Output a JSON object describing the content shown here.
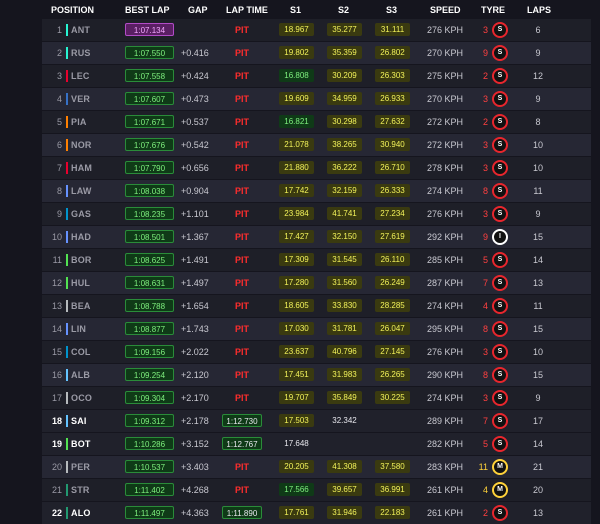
{
  "headers": {
    "position": "POSITION",
    "best_lap": "BEST LAP",
    "gap": "GAP",
    "lap_time": "LAP TIME",
    "s1": "S1",
    "s2": "S2",
    "s3": "S3",
    "speed": "SPEED",
    "tyre": "TYRE",
    "laps": "LAPS"
  },
  "colors": {
    "background": "#15151e",
    "pit": "#ff2d2d",
    "best_green": "#2a8c39",
    "best_purple": "#b24bc7",
    "sector_yellow": "#f3f35a",
    "soft_tyre": "#e8262d",
    "medium_tyre": "#ffd23a",
    "inter_tyre": "#ffffff"
  },
  "rows": [
    {
      "pos": "1",
      "team_color": "#27f4d2",
      "driver": "ANT",
      "best": "1:07.134",
      "best_kind": "purple",
      "gap": "",
      "lap": "PIT",
      "s1": "18.967",
      "s1c": "y",
      "s2": "35.277",
      "s2c": "y",
      "s3": "31.111",
      "s3c": "y",
      "speed": "276 KPH",
      "tyre_age": "3",
      "tyre": "S",
      "tyre_kind": "soft",
      "laps": "6"
    },
    {
      "pos": "2",
      "team_color": "#27f4d2",
      "driver": "RUS",
      "best": "1:07.550",
      "best_kind": "green",
      "gap": "+0.416",
      "lap": "PIT",
      "s1": "19.802",
      "s1c": "y",
      "s2": "35.359",
      "s2c": "y",
      "s3": "26.802",
      "s3c": "y",
      "speed": "270 KPH",
      "tyre_age": "9",
      "tyre": "S",
      "tyre_kind": "soft",
      "laps": "9"
    },
    {
      "pos": "3",
      "team_color": "#e8002d",
      "driver": "LEC",
      "best": "1:07.558",
      "best_kind": "green",
      "gap": "+0.424",
      "lap": "PIT",
      "s1": "16.808",
      "s1c": "g",
      "s2": "30.209",
      "s2c": "y",
      "s3": "26.303",
      "s3c": "y",
      "speed": "275 KPH",
      "tyre_age": "2",
      "tyre": "S",
      "tyre_kind": "soft",
      "laps": "12"
    },
    {
      "pos": "4",
      "team_color": "#3671c6",
      "driver": "VER",
      "best": "1:07.607",
      "best_kind": "green",
      "gap": "+0.473",
      "lap": "PIT",
      "s1": "19.609",
      "s1c": "y",
      "s2": "34.959",
      "s2c": "y",
      "s3": "26.933",
      "s3c": "y",
      "speed": "270 KPH",
      "tyre_age": "3",
      "tyre": "S",
      "tyre_kind": "soft",
      "laps": "9"
    },
    {
      "pos": "5",
      "team_color": "#ff8000",
      "driver": "PIA",
      "best": "1:07.671",
      "best_kind": "green",
      "gap": "+0.537",
      "lap": "PIT",
      "s1": "16.821",
      "s1c": "g",
      "s2": "30.298",
      "s2c": "y",
      "s3": "27.632",
      "s3c": "y",
      "speed": "272 KPH",
      "tyre_age": "2",
      "tyre": "S",
      "tyre_kind": "soft",
      "laps": "8"
    },
    {
      "pos": "6",
      "team_color": "#ff8000",
      "driver": "NOR",
      "best": "1:07.676",
      "best_kind": "green",
      "gap": "+0.542",
      "lap": "PIT",
      "s1": "21.078",
      "s1c": "y",
      "s2": "38.265",
      "s2c": "y",
      "s3": "30.940",
      "s3c": "y",
      "speed": "272 KPH",
      "tyre_age": "3",
      "tyre": "S",
      "tyre_kind": "soft",
      "laps": "10"
    },
    {
      "pos": "7",
      "team_color": "#e8002d",
      "driver": "HAM",
      "best": "1:07.790",
      "best_kind": "green",
      "gap": "+0.656",
      "lap": "PIT",
      "s1": "21.880",
      "s1c": "y",
      "s2": "36.222",
      "s2c": "y",
      "s3": "26.710",
      "s3c": "y",
      "speed": "278 KPH",
      "tyre_age": "3",
      "tyre": "S",
      "tyre_kind": "soft",
      "laps": "10"
    },
    {
      "pos": "8",
      "team_color": "#6692ff",
      "driver": "LAW",
      "best": "1:08.038",
      "best_kind": "green",
      "gap": "+0.904",
      "lap": "PIT",
      "s1": "17.742",
      "s1c": "y",
      "s2": "32.159",
      "s2c": "y",
      "s3": "26.333",
      "s3c": "y",
      "speed": "274 KPH",
      "tyre_age": "8",
      "tyre": "S",
      "tyre_kind": "soft",
      "laps": "11"
    },
    {
      "pos": "9",
      "team_color": "#0093cc",
      "driver": "GAS",
      "best": "1:08.235",
      "best_kind": "green",
      "gap": "+1.101",
      "lap": "PIT",
      "s1": "23.984",
      "s1c": "y",
      "s2": "41.741",
      "s2c": "y",
      "s3": "27.234",
      "s3c": "y",
      "speed": "276 KPH",
      "tyre_age": "3",
      "tyre": "S",
      "tyre_kind": "soft",
      "laps": "9"
    },
    {
      "pos": "10",
      "team_color": "#6692ff",
      "driver": "HAD",
      "best": "1:08.501",
      "best_kind": "green",
      "gap": "+1.367",
      "lap": "PIT",
      "s1": "17.427",
      "s1c": "y",
      "s2": "32.150",
      "s2c": "y",
      "s3": "27.619",
      "s3c": "y",
      "speed": "292 KPH",
      "tyre_age": "9",
      "tyre": "I",
      "tyre_kind": "inter",
      "laps": "15"
    },
    {
      "pos": "11",
      "team_color": "#52e252",
      "driver": "BOR",
      "best": "1:08.625",
      "best_kind": "green",
      "gap": "+1.491",
      "lap": "PIT",
      "s1": "17.309",
      "s1c": "y",
      "s2": "31.545",
      "s2c": "y",
      "s3": "26.110",
      "s3c": "y",
      "speed": "285 KPH",
      "tyre_age": "5",
      "tyre": "S",
      "tyre_kind": "soft",
      "laps": "14"
    },
    {
      "pos": "12",
      "team_color": "#52e252",
      "driver": "HUL",
      "best": "1:08.631",
      "best_kind": "green",
      "gap": "+1.497",
      "lap": "PIT",
      "s1": "17.280",
      "s1c": "y",
      "s2": "31.560",
      "s2c": "y",
      "s3": "26.249",
      "s3c": "y",
      "speed": "287 KPH",
      "tyre_age": "7",
      "tyre": "S",
      "tyre_kind": "soft",
      "laps": "13"
    },
    {
      "pos": "13",
      "team_color": "#b6babd",
      "driver": "BEA",
      "best": "1:08.788",
      "best_kind": "green",
      "gap": "+1.654",
      "lap": "PIT",
      "s1": "18.605",
      "s1c": "y",
      "s2": "33.830",
      "s2c": "y",
      "s3": "28.285",
      "s3c": "y",
      "speed": "274 KPH",
      "tyre_age": "4",
      "tyre": "S",
      "tyre_kind": "soft",
      "laps": "11"
    },
    {
      "pos": "14",
      "team_color": "#6692ff",
      "driver": "LIN",
      "best": "1:08.877",
      "best_kind": "green",
      "gap": "+1.743",
      "lap": "PIT",
      "s1": "17.030",
      "s1c": "y",
      "s2": "31.781",
      "s2c": "y",
      "s3": "26.047",
      "s3c": "y",
      "speed": "295 KPH",
      "tyre_age": "8",
      "tyre": "S",
      "tyre_kind": "soft",
      "laps": "15"
    },
    {
      "pos": "15",
      "team_color": "#0093cc",
      "driver": "COL",
      "best": "1:09.156",
      "best_kind": "green",
      "gap": "+2.022",
      "lap": "PIT",
      "s1": "23.637",
      "s1c": "y",
      "s2": "40.796",
      "s2c": "y",
      "s3": "27.145",
      "s3c": "y",
      "speed": "276 KPH",
      "tyre_age": "3",
      "tyre": "S",
      "tyre_kind": "soft",
      "laps": "10"
    },
    {
      "pos": "16",
      "team_color": "#64c4ff",
      "driver": "ALB",
      "best": "1:09.254",
      "best_kind": "green",
      "gap": "+2.120",
      "lap": "PIT",
      "s1": "17.451",
      "s1c": "y",
      "s2": "31.983",
      "s2c": "y",
      "s3": "26.265",
      "s3c": "y",
      "speed": "290 KPH",
      "tyre_age": "8",
      "tyre": "S",
      "tyre_kind": "soft",
      "laps": "15"
    },
    {
      "pos": "17",
      "team_color": "#b6babd",
      "driver": "OCO",
      "best": "1:09.304",
      "best_kind": "green",
      "gap": "+2.170",
      "lap": "PIT",
      "s1": "19.707",
      "s1c": "y",
      "s2": "35.849",
      "s2c": "y",
      "s3": "30.225",
      "s3c": "y",
      "speed": "274 KPH",
      "tyre_age": "3",
      "tyre": "S",
      "tyre_kind": "soft",
      "laps": "9"
    },
    {
      "pos": "18",
      "team_color": "#64c4ff",
      "driver": "SAI",
      "best": "1:09.312",
      "best_kind": "green",
      "gap": "+2.178",
      "lap": "1:12.730",
      "s1": "17.503",
      "s1c": "y",
      "s2": "32.342",
      "s2c": "w",
      "s3": "",
      "s3c": "w",
      "speed": "289 KPH",
      "tyre_age": "7",
      "tyre": "S",
      "tyre_kind": "soft",
      "laps": "17",
      "active": true
    },
    {
      "pos": "19",
      "team_color": "#52e252",
      "driver": "BOT",
      "best": "1:10.286",
      "best_kind": "green",
      "gap": "+3.152",
      "lap": "1:12.767",
      "s1": "17.648",
      "s1c": "w",
      "s2": "",
      "s2c": "w",
      "s3": "",
      "s3c": "w",
      "speed": "282 KPH",
      "tyre_age": "5",
      "tyre": "S",
      "tyre_kind": "soft",
      "laps": "14",
      "active": true
    },
    {
      "pos": "20",
      "team_color": "#b6babd",
      "driver": "PER",
      "best": "1:10.537",
      "best_kind": "green",
      "gap": "+3.403",
      "lap": "PIT",
      "s1": "20.205",
      "s1c": "y",
      "s2": "41.308",
      "s2c": "y",
      "s3": "37.580",
      "s3c": "y",
      "speed": "283 KPH",
      "tyre_age": "11",
      "tyre": "M",
      "tyre_kind": "med",
      "laps": "21"
    },
    {
      "pos": "21",
      "team_color": "#229971",
      "driver": "STR",
      "best": "1:11.402",
      "best_kind": "green",
      "gap": "+4.268",
      "lap": "PIT",
      "s1": "17.566",
      "s1c": "g",
      "s2": "39.657",
      "s2c": "y",
      "s3": "36.991",
      "s3c": "y",
      "speed": "261 KPH",
      "tyre_age": "4",
      "tyre": "M",
      "tyre_kind": "med",
      "laps": "20"
    },
    {
      "pos": "22",
      "team_color": "#229971",
      "driver": "ALO",
      "best": "1:11.497",
      "best_kind": "green",
      "gap": "+4.363",
      "lap": "1:11.890",
      "s1": "17.761",
      "s1c": "y",
      "s2": "31.946",
      "s2c": "y",
      "s3": "22.183",
      "s3c": "y",
      "speed": "261 KPH",
      "tyre_age": "2",
      "tyre": "S",
      "tyre_kind": "soft",
      "laps": "13",
      "active": true
    }
  ]
}
